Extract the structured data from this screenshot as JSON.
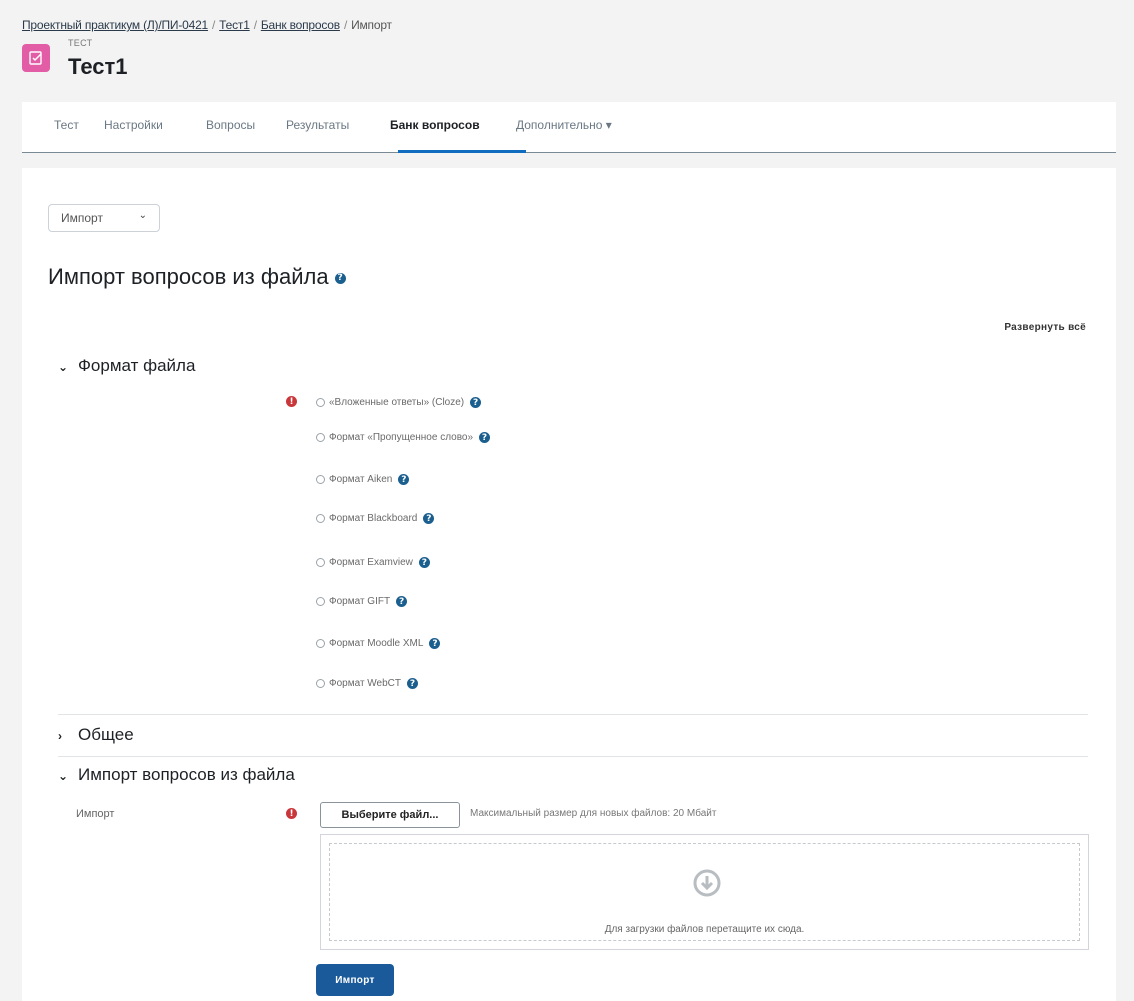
{
  "breadcrumb": {
    "items": [
      "Проектный практикум (Л)/ПИ-0421",
      "Тест1",
      "Банк вопросов"
    ],
    "current": "Импорт",
    "separator": "/"
  },
  "activity": {
    "type": "ТЕСТ",
    "title": "Тест1",
    "icon": "quiz-icon",
    "color": "#e35ca6"
  },
  "tabs": [
    {
      "label": "Тест"
    },
    {
      "label": "Настройки"
    },
    {
      "label": "Вопросы"
    },
    {
      "label": "Результаты"
    },
    {
      "label": "Банк вопросов",
      "active": true
    },
    {
      "label": "Дополнительно",
      "dropdown": true,
      "caret": "▾"
    }
  ],
  "accent_color": "#0f6cbf",
  "action_select": {
    "value": "Импорт",
    "chevron": "⌄"
  },
  "page_heading": "Импорт вопросов из файла",
  "help_glyph": "?",
  "required_glyph": "!",
  "expand_all": "Развернуть всё",
  "sections": {
    "format": {
      "title": "Формат файла",
      "expanded": true,
      "caret": "⌄",
      "options": [
        {
          "label": "«Вложенные ответы» (Cloze)"
        },
        {
          "label": "Формат «Пропущенное слово»"
        },
        {
          "label": "Формат Aiken"
        },
        {
          "label": "Формат Blackboard"
        },
        {
          "label": "Формат Examview"
        },
        {
          "label": "Формат GIFT"
        },
        {
          "label": "Формат Moodle XML"
        },
        {
          "label": "Формат WebCT"
        }
      ]
    },
    "general": {
      "title": "Общее",
      "expanded": false,
      "caret": "›"
    },
    "import": {
      "title": "Импорт вопросов из файла",
      "expanded": true,
      "caret": "⌄",
      "field_label": "Импорт",
      "choose_file": "Выберите файл...",
      "max_size": "Максимальный размер для новых файлов: 20 Мбайт",
      "dropzone_text": "Для загрузки файлов перетащите их сюда.",
      "submit": "Импорт"
    }
  }
}
